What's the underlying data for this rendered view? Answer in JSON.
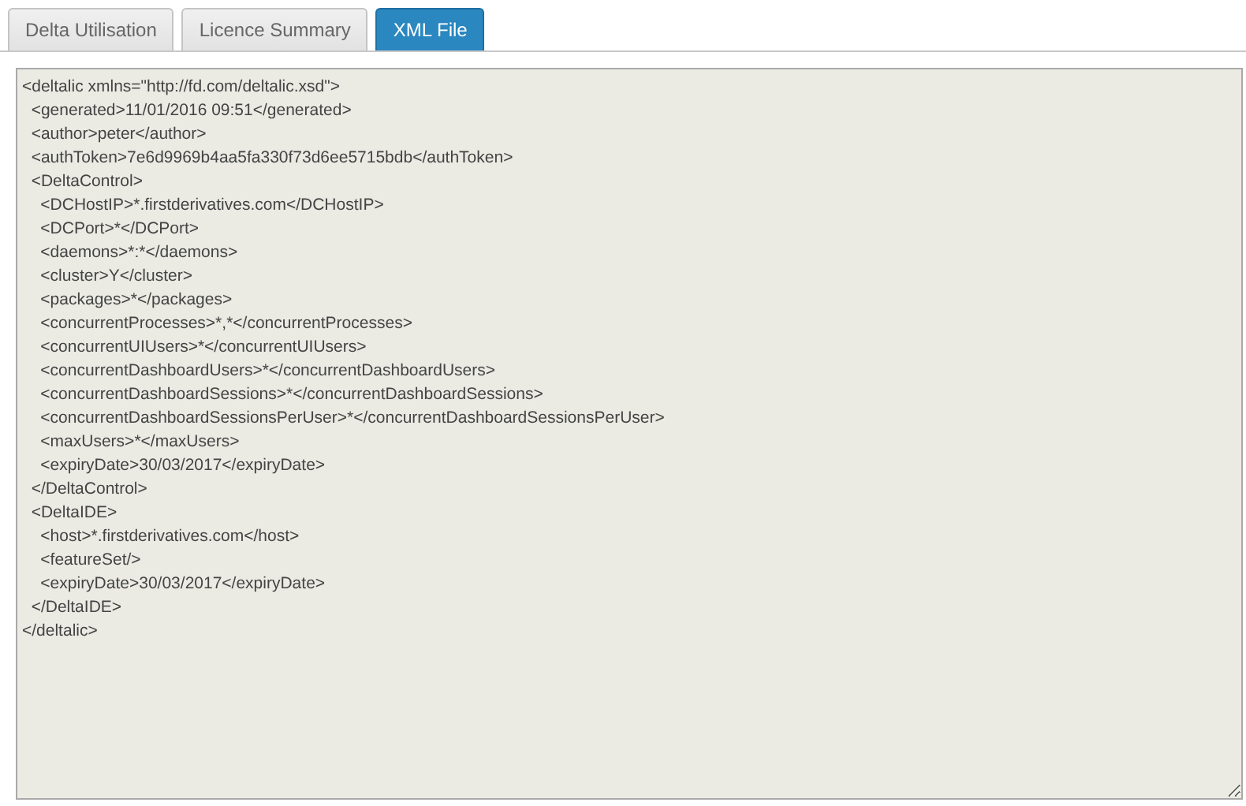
{
  "tabs": [
    {
      "label": "Delta Utilisation",
      "selected": false
    },
    {
      "label": "Licence Summary",
      "selected": false
    },
    {
      "label": "XML File",
      "selected": true
    }
  ],
  "xml_field": {
    "value_lines": [
      "<deltalic xmlns=\"http://fd.com/deltalic.xsd\">",
      "  <generated>11/01/2016 09:51</generated>",
      "  <author>peter</author>",
      "  <authToken>7e6d9969b4aa5fa330f73d6ee5715bdb</authToken>",
      "  <DeltaControl>",
      "    <DCHostIP>*.firstderivatives.com</DCHostIP>",
      "    <DCPort>*</DCPort>",
      "    <daemons>*:*</daemons>",
      "    <cluster>Y</cluster>",
      "    <packages>*</packages>",
      "    <concurrentProcesses>*,*</concurrentProcesses>",
      "    <concurrentUIUsers>*</concurrentUIUsers>",
      "    <concurrentDashboardUsers>*</concurrentDashboardUsers>",
      "    <concurrentDashboardSessions>*</concurrentDashboardSessions>",
      "    <concurrentDashboardSessionsPerUser>*</concurrentDashboardSessionsPerUser>",
      "    <maxUsers>*</maxUsers>",
      "    <expiryDate>30/03/2017</expiryDate>",
      "  </DeltaControl>",
      "  <DeltaIDE>",
      "    <host>*.firstderivatives.com</host>",
      "    <featureSet/>",
      "    <expiryDate>30/03/2017</expiryDate>",
      "  </DeltaIDE>",
      "</deltalic>"
    ]
  }
}
